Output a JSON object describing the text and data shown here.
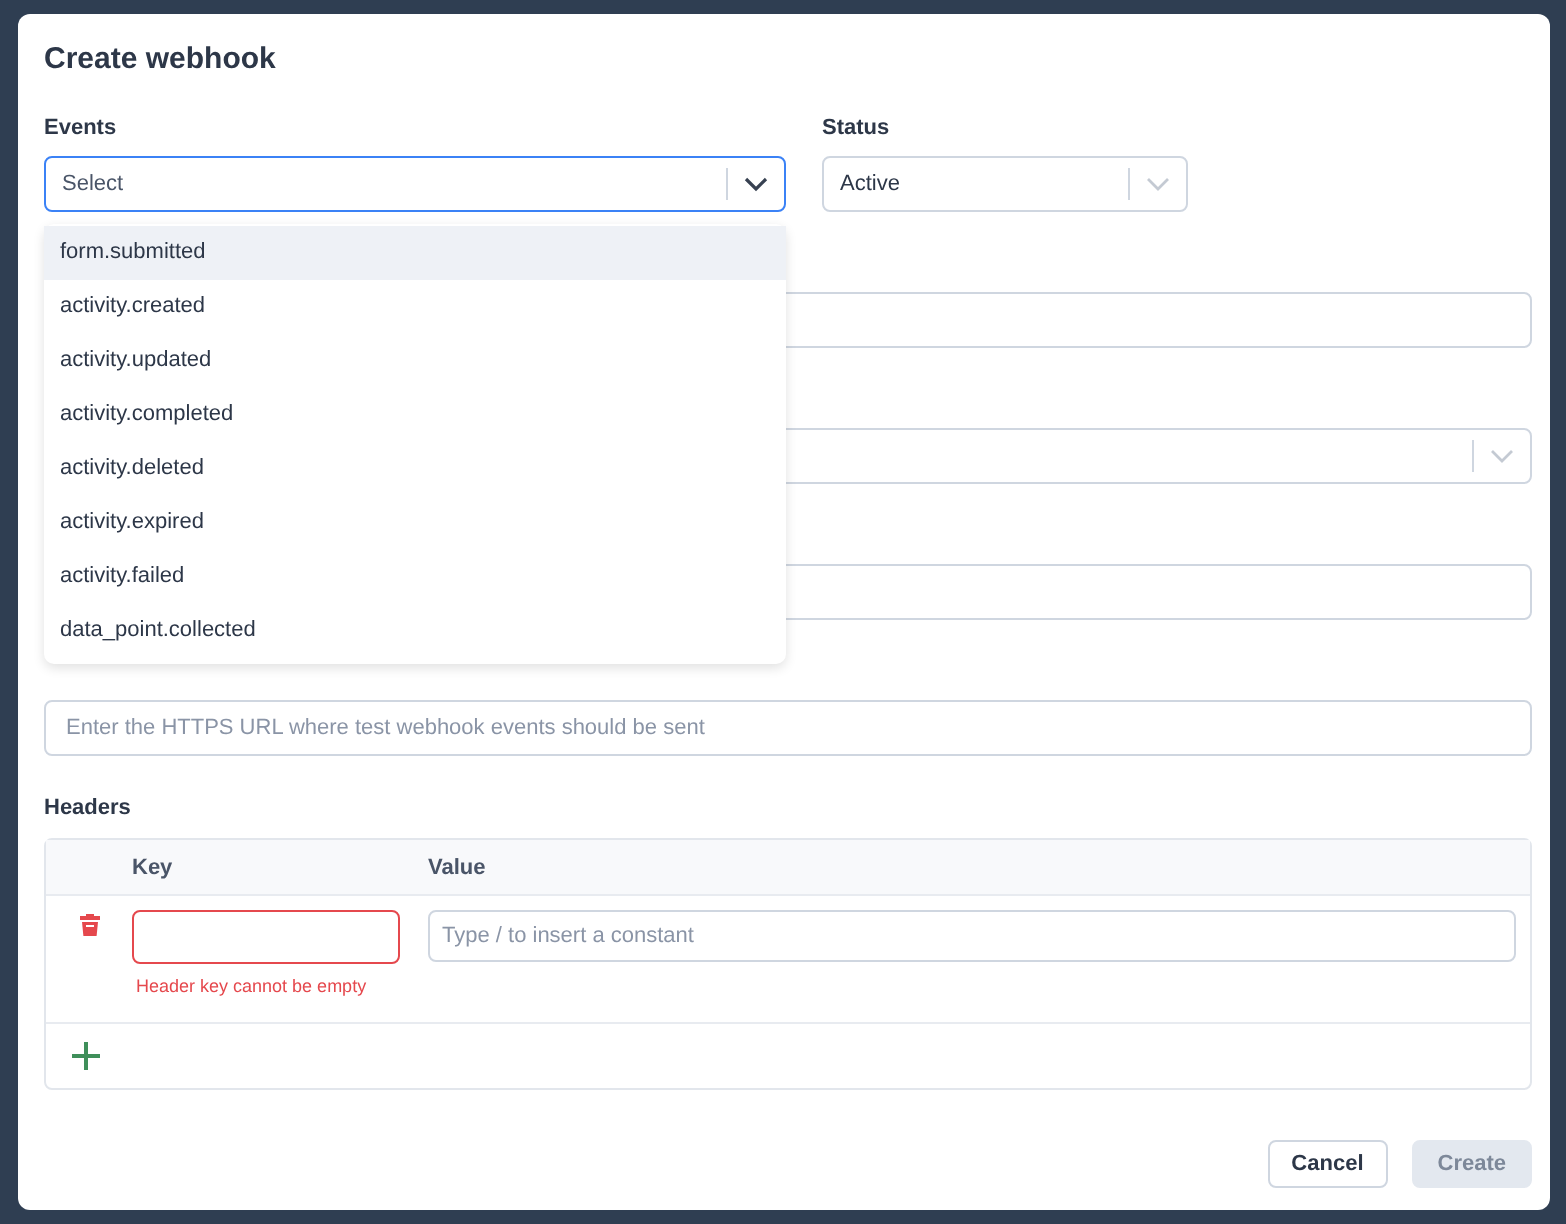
{
  "dialog": {
    "title": "Create webhook"
  },
  "events": {
    "label": "Events",
    "placeholder": "Select",
    "expanded": true,
    "options": [
      {
        "label": "form.submitted",
        "selected": true
      },
      {
        "label": "activity.created",
        "selected": false
      },
      {
        "label": "activity.updated",
        "selected": false
      },
      {
        "label": "activity.completed",
        "selected": false
      },
      {
        "label": "activity.deleted",
        "selected": false
      },
      {
        "label": "activity.expired",
        "selected": false
      },
      {
        "label": "activity.failed",
        "selected": false
      },
      {
        "label": "data_point.collected",
        "selected": false
      }
    ]
  },
  "status": {
    "label": "Status",
    "value": "Active"
  },
  "hidden_fields": [
    {
      "kind": "input"
    },
    {
      "kind": "select"
    },
    {
      "kind": "input"
    }
  ],
  "test_endpoint": {
    "placeholder": "Enter the HTTPS URL where test webhook events should be sent"
  },
  "headers": {
    "label": "Headers",
    "columns": [
      "Key",
      "Value"
    ],
    "rows": [
      {
        "value_placeholder": "Type / to insert a constant",
        "error": "Header key cannot be empty"
      }
    ]
  },
  "buttons": [
    {
      "label": "Cancel",
      "disabled": false
    },
    {
      "label": "Create",
      "disabled": true
    }
  ]
}
